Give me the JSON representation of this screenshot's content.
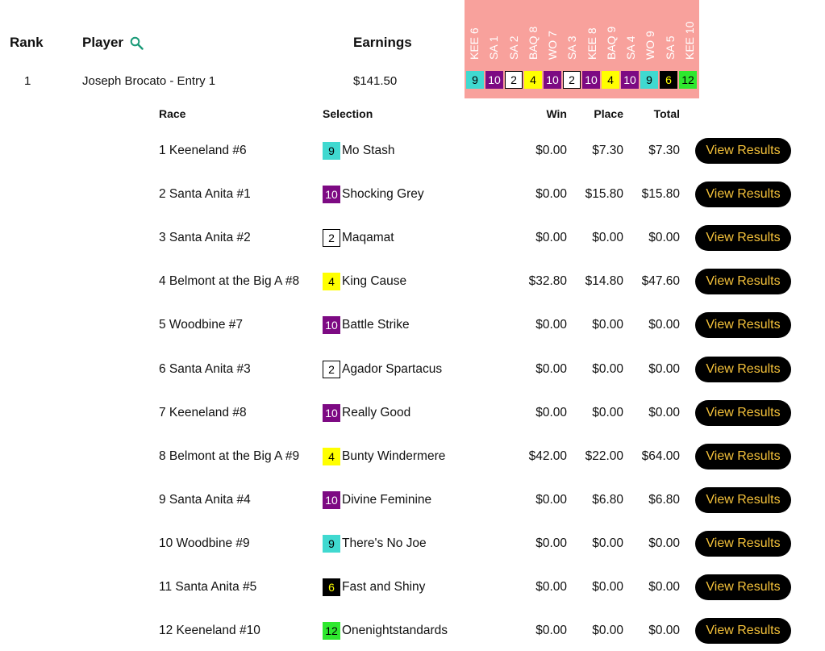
{
  "header": {
    "rank": "Rank",
    "player": "Player",
    "earnings": "Earnings"
  },
  "race_codes": [
    "KEE 6",
    "SA 1",
    "SA 2",
    "BAQ 8",
    "WO 7",
    "SA 3",
    "KEE 8",
    "BAQ 9",
    "SA 4",
    "WO 9",
    "SA 5",
    "KEE 10"
  ],
  "player": {
    "rank": "1",
    "name": "Joseph Brocato - Entry 1",
    "earnings": "$141.50"
  },
  "columns": {
    "race": "Race",
    "selection": "Selection",
    "win": "Win",
    "place": "Place",
    "total": "Total"
  },
  "button_label": "View Results",
  "colors": {
    "header_pink": "#f8a19c",
    "button_bg": "#000000",
    "button_text": "#f5c23a"
  },
  "program_styles": {
    "9": {
      "bg": "#40d9d0",
      "fg": "#000000",
      "border": "none"
    },
    "10": {
      "bg": "#7d0a83",
      "fg": "#ffffff",
      "border": "none"
    },
    "2": {
      "bg": "#ffffff",
      "fg": "#000000",
      "border": "#000000"
    },
    "4": {
      "bg": "#ffff00",
      "fg": "#000000",
      "border": "none"
    },
    "6": {
      "bg": "#000000",
      "fg": "#ffff00",
      "border": "none"
    },
    "12": {
      "bg": "#2ee82e",
      "fg": "#000000",
      "border": "none"
    }
  },
  "rows": [
    {
      "race": "1 Keeneland #6",
      "pgm": "9",
      "horse": "Mo Stash",
      "win": "$0.00",
      "place": "$7.30",
      "total": "$7.30"
    },
    {
      "race": "2 Santa Anita #1",
      "pgm": "10",
      "horse": "Shocking Grey",
      "win": "$0.00",
      "place": "$15.80",
      "total": "$15.80"
    },
    {
      "race": "3 Santa Anita #2",
      "pgm": "2",
      "horse": "Maqamat",
      "win": "$0.00",
      "place": "$0.00",
      "total": "$0.00"
    },
    {
      "race": "4 Belmont at the Big A #8",
      "pgm": "4",
      "horse": "King Cause",
      "win": "$32.80",
      "place": "$14.80",
      "total": "$47.60"
    },
    {
      "race": "5 Woodbine #7",
      "pgm": "10",
      "horse": "Battle Strike",
      "win": "$0.00",
      "place": "$0.00",
      "total": "$0.00"
    },
    {
      "race": "6 Santa Anita #3",
      "pgm": "2",
      "horse": "Agador Spartacus",
      "win": "$0.00",
      "place": "$0.00",
      "total": "$0.00"
    },
    {
      "race": "7 Keeneland #8",
      "pgm": "10",
      "horse": "Really Good",
      "win": "$0.00",
      "place": "$0.00",
      "total": "$0.00"
    },
    {
      "race": "8 Belmont at the Big A #9",
      "pgm": "4",
      "horse": "Bunty Windermere",
      "win": "$42.00",
      "place": "$22.00",
      "total": "$64.00"
    },
    {
      "race": "9 Santa Anita #4",
      "pgm": "10",
      "horse": "Divine Feminine",
      "win": "$0.00",
      "place": "$6.80",
      "total": "$6.80"
    },
    {
      "race": "10 Woodbine #9",
      "pgm": "9",
      "horse": "There's No Joe",
      "win": "$0.00",
      "place": "$0.00",
      "total": "$0.00"
    },
    {
      "race": "11 Santa Anita #5",
      "pgm": "6",
      "horse": "Fast and Shiny",
      "win": "$0.00",
      "place": "$0.00",
      "total": "$0.00"
    },
    {
      "race": "12 Keeneland #10",
      "pgm": "12",
      "horse": "Onenightstandards",
      "win": "$0.00",
      "place": "$0.00",
      "total": "$0.00"
    }
  ]
}
